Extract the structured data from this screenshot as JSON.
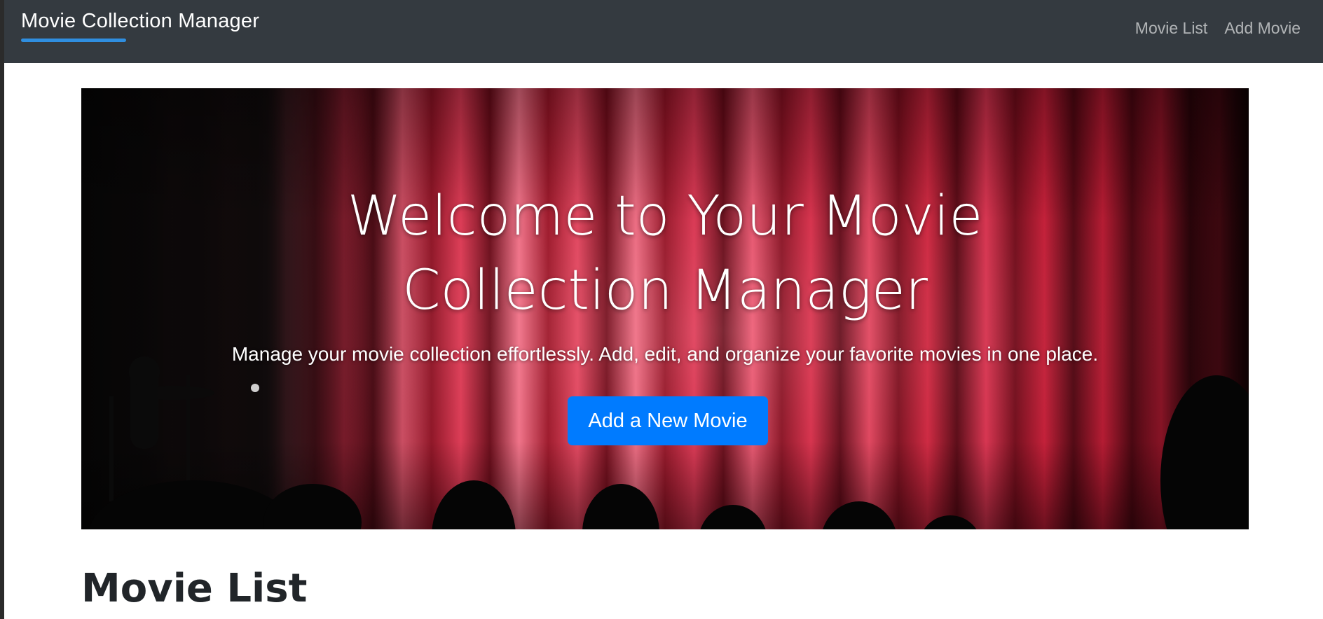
{
  "navbar": {
    "brand": "Movie Collection Manager",
    "links": [
      "Movie List",
      "Add Movie"
    ]
  },
  "hero": {
    "title": "Welcome to Your Movie Collection Manager",
    "subtitle": "Manage your movie collection effortlessly. Add, edit, and organize your favorite movies in one place.",
    "button_label": "Add a New Movie",
    "background": "red-theater-curtain-with-audience-silhouettes"
  },
  "main": {
    "section_title": "Movie List"
  },
  "colors": {
    "navbar_bg": "#343a40",
    "brand_underline": "#2f8ee0",
    "primary_button": "#007bff",
    "heading_text": "#212529"
  }
}
